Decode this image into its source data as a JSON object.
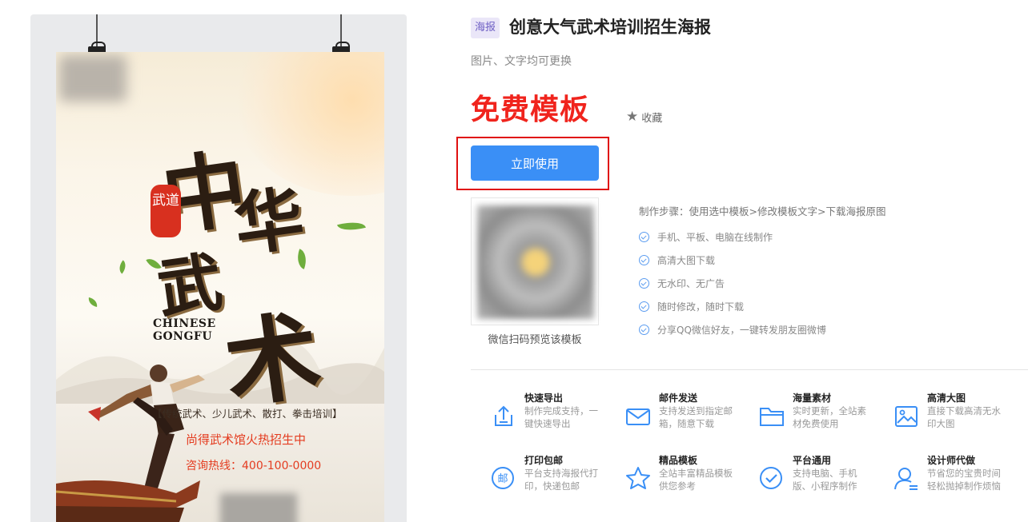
{
  "poster": {
    "calligraphy_1": "中",
    "calligraphy_2": "华",
    "calligraphy_3": "武",
    "calligraphy_4": "术",
    "seal": "武道",
    "en_title_1": "CHINESE",
    "en_title_2": "GONGFU",
    "sub": "【传统武术、少儿武术、散打、拳击培训】",
    "headline": "尚得武术馆火热招生中",
    "hotline": "咨询热线：400-100-0000"
  },
  "header": {
    "badge": "海报",
    "title": "创意大气武术培训招生海报",
    "subtitle": "图片、文字均可更换"
  },
  "price_label": "免费模板",
  "favorite_label": "收藏",
  "use_button_label": "立即使用",
  "qr_caption": "微信扫码预览该模板",
  "steps": {
    "title": "制作步骤：使用选中模板>修改模板文字>下载海报原图",
    "features": [
      "手机、平板、电脑在线制作",
      "高清大图下载",
      "无水印、无广告",
      "随时修改，随时下载",
      "分享QQ微信好友，一键转发朋友圈微博"
    ]
  },
  "services": [
    {
      "title": "快速导出",
      "desc": "制作完成支持，一键快速导出",
      "icon": "export-icon"
    },
    {
      "title": "邮件发送",
      "desc": "支持发送到指定邮箱，随意下载",
      "icon": "mail-icon"
    },
    {
      "title": "海量素材",
      "desc": "实时更新，全站素材免费使用",
      "icon": "folder-icon"
    },
    {
      "title": "高清大图",
      "desc": "直接下载高清无水印大图",
      "icon": "image-icon"
    },
    {
      "title": "打印包邮",
      "desc": "平台支持海报代打印，快递包邮",
      "icon": "post-icon",
      "glyph": "邮"
    },
    {
      "title": "精品模板",
      "desc": "全站丰富精品模板供您参考",
      "icon": "star-icon"
    },
    {
      "title": "平台通用",
      "desc": "支持电脑、手机版、小程序制作",
      "icon": "check-circle-icon"
    },
    {
      "title": "设计师代做",
      "desc": "节省您的宝贵时间轻松抛掉制作烦恼",
      "icon": "designer-icon"
    }
  ],
  "colors": {
    "accent": "#3a8ff6",
    "free_red": "#f0241d",
    "badge_bg": "#eae6f8",
    "badge_text": "#6e5fc4"
  }
}
